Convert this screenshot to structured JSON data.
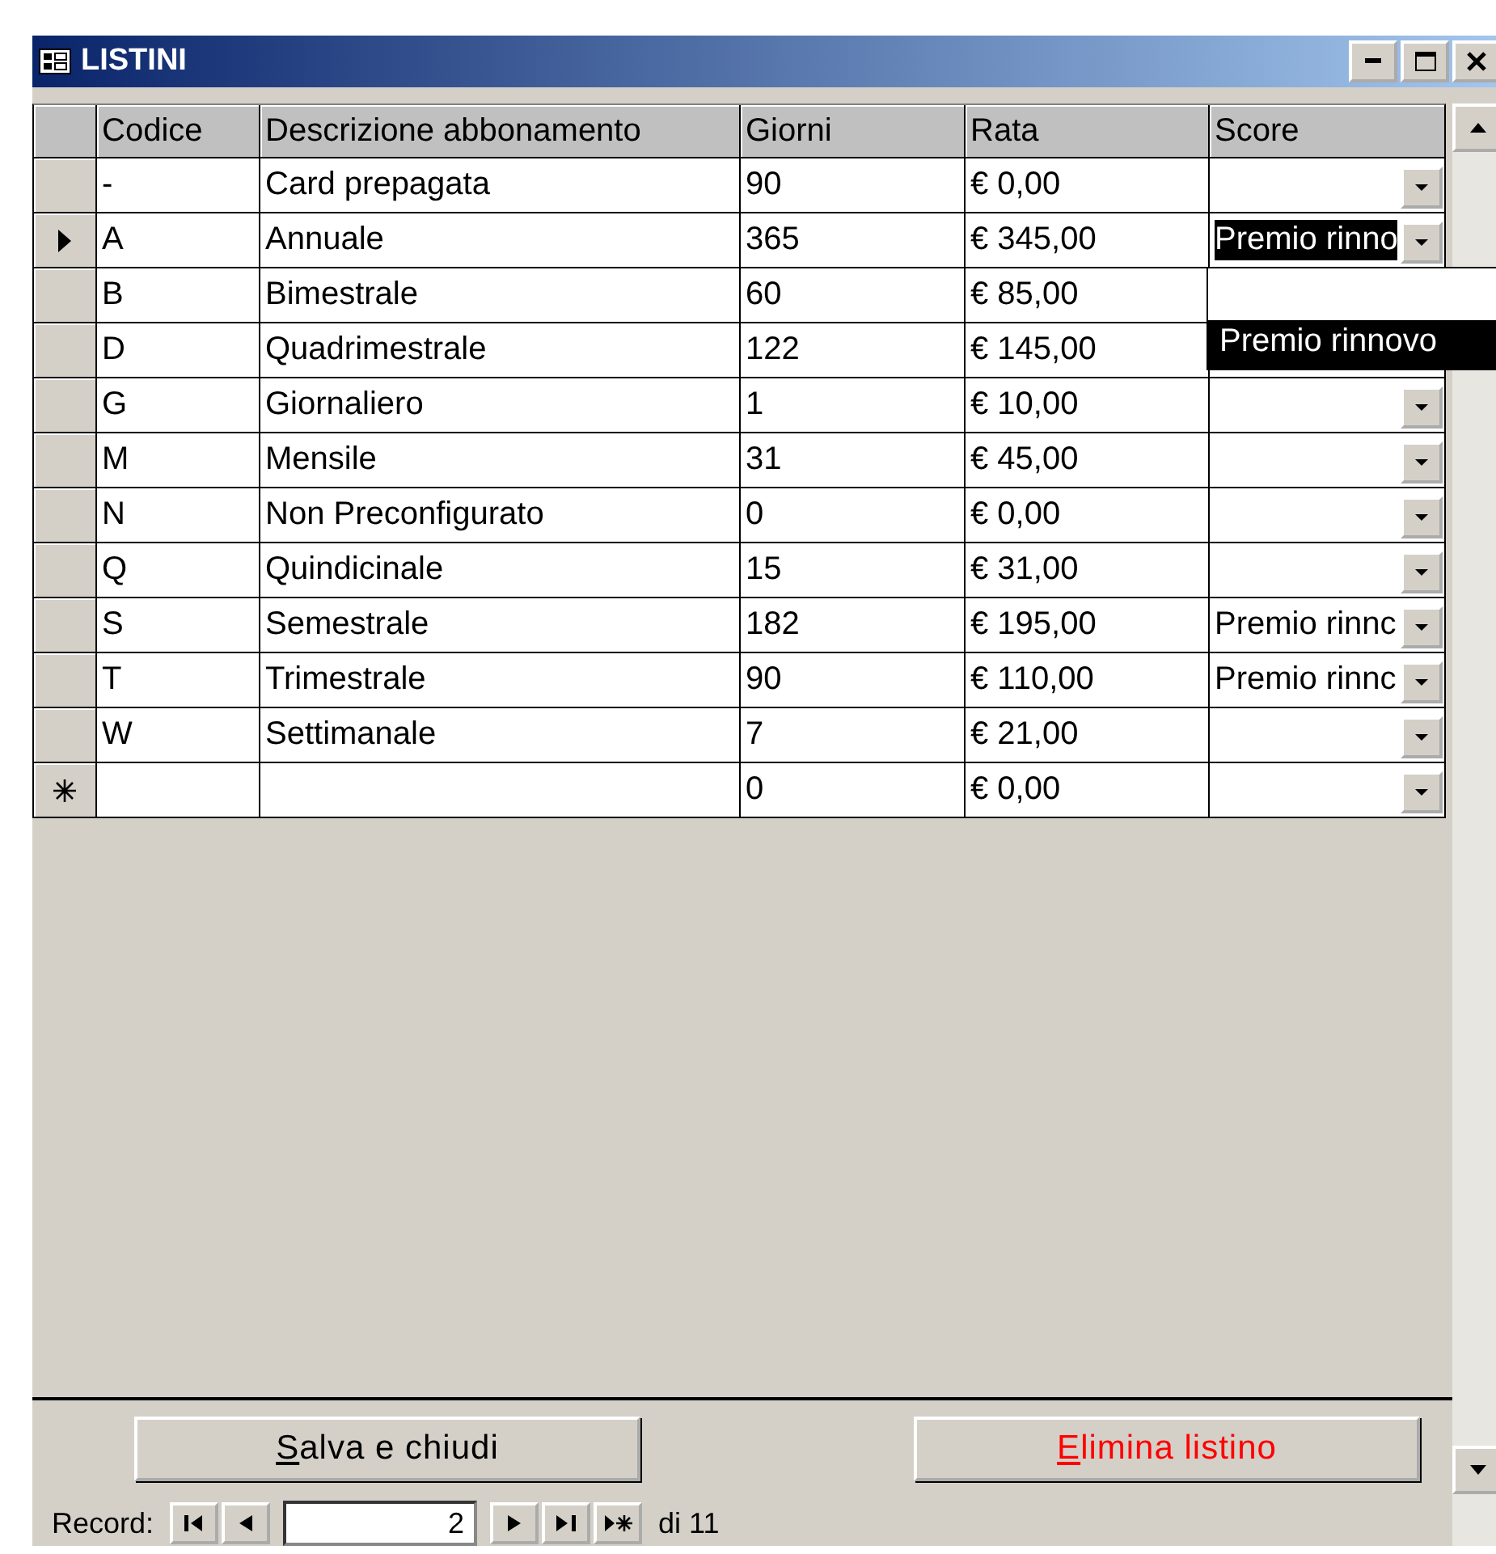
{
  "window": {
    "title": "LISTINI"
  },
  "table": {
    "columns": [
      "Codice",
      "Descrizione abbonamento",
      "Giorni",
      "Rata",
      "Score"
    ],
    "rows": [
      {
        "codice": "-",
        "descrizione": "Card prepagata",
        "giorni": "90",
        "rata": "€ 0,00",
        "current": false
      },
      {
        "codice": "A",
        "descrizione": "Annuale",
        "giorni": "365",
        "rata": "€ 345,00",
        "score": "Premio rinno",
        "current": true
      },
      {
        "codice": "B",
        "descrizione": "Bimestrale",
        "giorni": "60",
        "rata": "€ 85,00",
        "current": false
      },
      {
        "codice": "D",
        "descrizione": "Quadrimestrale",
        "giorni": "122",
        "rata": "€ 145,00",
        "current": false
      },
      {
        "codice": "G",
        "descrizione": "Giornaliero",
        "giorni": "1",
        "rata": "€ 10,00",
        "current": false
      },
      {
        "codice": "M",
        "descrizione": "Mensile",
        "giorni": "31",
        "rata": "€ 45,00",
        "current": false
      },
      {
        "codice": "N",
        "descrizione": "Non  Preconfigurato",
        "giorni": "0",
        "rata": "€ 0,00",
        "current": false
      },
      {
        "codice": "Q",
        "descrizione": "Quindicinale",
        "giorni": "15",
        "rata": "€ 31,00",
        "current": false
      },
      {
        "codice": "S",
        "descrizione": "Semestrale",
        "giorni": "182",
        "rata": "€ 195,00",
        "score": "Premio rinnc",
        "current": false
      },
      {
        "codice": "T",
        "descrizione": "Trimestrale",
        "giorni": "90",
        "rata": "€ 110,00",
        "score": "Premio rinnc",
        "current": false
      },
      {
        "codice": "W",
        "descrizione": "Settimanale",
        "giorni": "7",
        "rata": "€ 21,00",
        "current": false
      }
    ],
    "new_row": {
      "giorni": "0",
      "rata": "€ 0,00"
    }
  },
  "dropdown": {
    "options": [
      {
        "label": "Premio rinnovo",
        "selected": true
      }
    ]
  },
  "buttons": [
    {
      "label": "Salva e chiudi",
      "kind": "normal"
    },
    {
      "label": "Elimina listino",
      "kind": "danger"
    }
  ],
  "navigator": {
    "label": "Record:",
    "current": "2",
    "total": "di 11"
  }
}
